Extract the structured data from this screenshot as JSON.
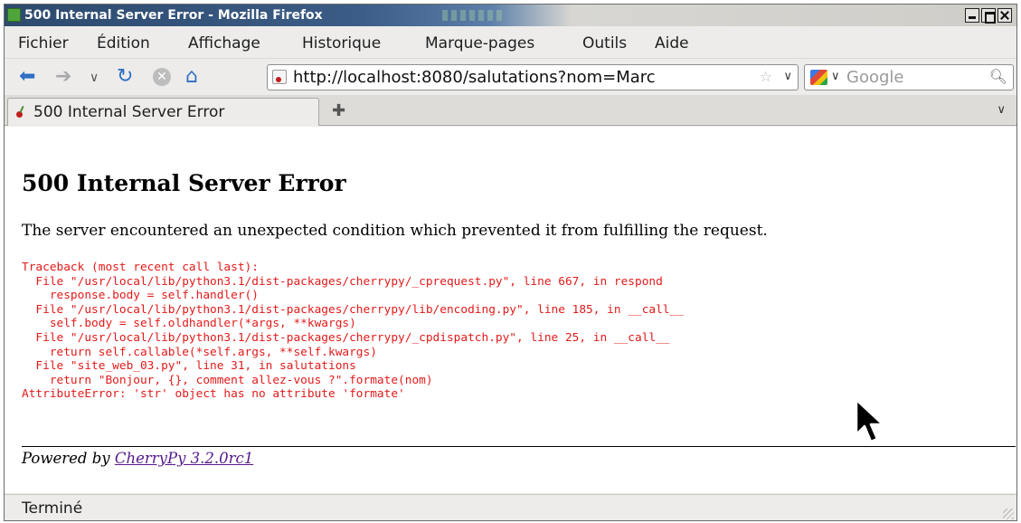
{
  "window": {
    "title": "500 Internal Server Error - Mozilla Firefox"
  },
  "menu": {
    "items": [
      "Fichier",
      "Édition",
      "Affichage",
      "Historique",
      "Marque-pages",
      "Outils",
      "Aide"
    ]
  },
  "navbar": {
    "url": "http://localhost:8080/salutations?nom=Marc",
    "search_placeholder": "Google"
  },
  "tabs": {
    "active_label": "500 Internal Server Error"
  },
  "page": {
    "heading": "500 Internal Server Error",
    "message": "The server encountered an unexpected condition which prevented it from fulfilling the request.",
    "traceback": "Traceback (most recent call last):\n  File \"/usr/local/lib/python3.1/dist-packages/cherrypy/_cprequest.py\", line 667, in respond\n    response.body = self.handler()\n  File \"/usr/local/lib/python3.1/dist-packages/cherrypy/lib/encoding.py\", line 185, in __call__\n    self.body = self.oldhandler(*args, **kwargs)\n  File \"/usr/local/lib/python3.1/dist-packages/cherrypy/_cpdispatch.py\", line 25, in __call__\n    return self.callable(*self.args, **self.kwargs)\n  File \"site_web_03.py\", line 31, in salutations\n    return \"Bonjour, {}, comment allez-vous ?\".formate(nom)\nAttributeError: 'str' object has no attribute 'formate'",
    "powered_prefix": "Powered by",
    "powered_link": "CherryPy 3.2.0rc1"
  },
  "status": {
    "text": "Terminé"
  },
  "colors": {
    "traceback": "#e31a1a",
    "link_visited": "#551a8b",
    "titlebar_active": "#2d4a6e"
  },
  "icons": [
    "firefox-app-icon",
    "minimize-icon",
    "maximize-icon",
    "close-icon",
    "back-arrow-icon",
    "forward-arrow-icon",
    "history-dropdown-icon",
    "reload-icon",
    "stop-icon",
    "home-icon",
    "site-favicon",
    "bookmark-star-icon",
    "url-dropdown-icon",
    "google-engine-icon",
    "search-engine-dropdown-icon",
    "magnifier-icon",
    "new-tab-icon",
    "tab-list-icon",
    "mouse-cursor-icon",
    "resize-grip-icon"
  ]
}
